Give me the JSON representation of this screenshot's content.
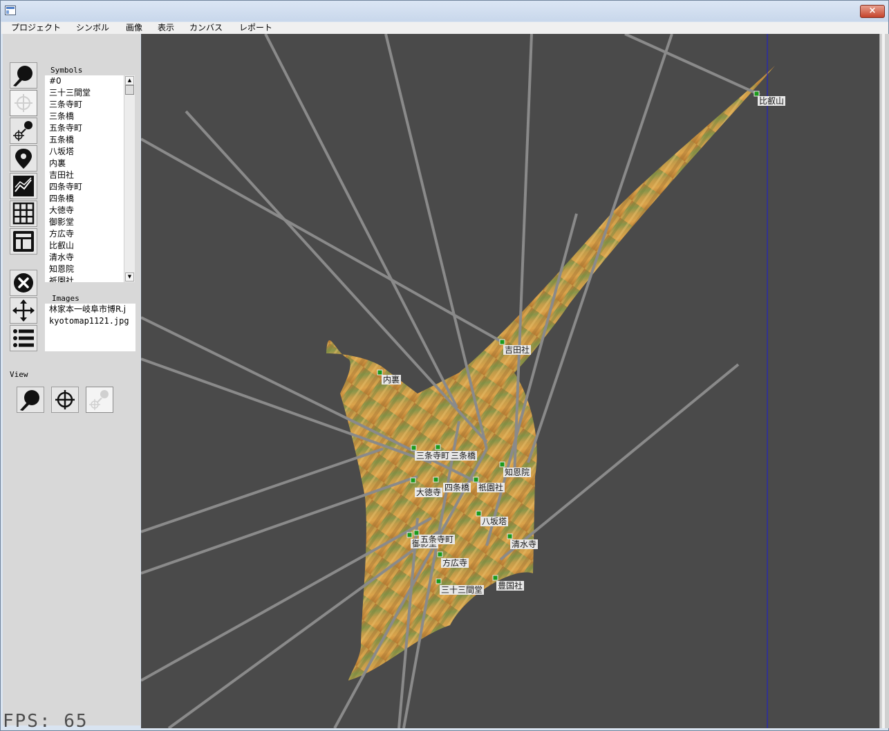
{
  "window": {
    "close_label": "×"
  },
  "menu": [
    "プロジェクト",
    "シンボル",
    "画像",
    "表示",
    "カンバス",
    "レポート"
  ],
  "panel": {
    "symbols_label": "Symbols",
    "images_label": "Images",
    "view_label": "View",
    "symbols": [
      "#0",
      "三十三間堂",
      "三条寺町",
      "三条橋",
      "五条寺町",
      "五条橋",
      "八坂塔",
      "内裏",
      "吉田社",
      "四条寺町",
      "四条橋",
      "大徳寺",
      "御影堂",
      "方広寺",
      "比叡山",
      "清水寺",
      "知恩院",
      "祇園社"
    ],
    "images": [
      "林家本一岐阜市博R.j",
      "kyotomap1121.jpg"
    ],
    "tools": [
      "zoom-pan-icon",
      "target-crosshair-icon",
      "point-zoom-icon",
      "map-pin-icon",
      "chart-icon",
      "grid-icon",
      "layout-icon",
      "delete-icon",
      "move-icon",
      "list-icon"
    ]
  },
  "fps": "FPS: 65",
  "map_labels": [
    "比叡山",
    "吉田社",
    "内裏",
    "三条寺町",
    "三条橋",
    "知恩院",
    "大徳寺",
    "四条橋",
    "祇園社",
    "八坂塔",
    "御影堂",
    "五条寺町",
    "清水寺",
    "方広寺",
    "三十三間堂",
    "豊国社"
  ]
}
